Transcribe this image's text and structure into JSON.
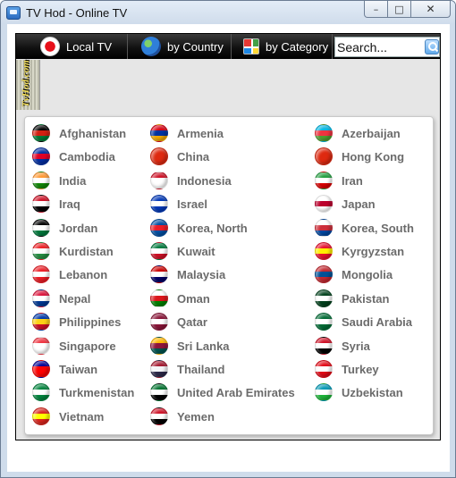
{
  "window": {
    "title": "TV Hod - Online TV",
    "controls": {
      "minimize": "–",
      "maximize": "□",
      "close": "✕"
    }
  },
  "nav": {
    "local": "Local TV",
    "country": "by Country",
    "category": "by Category",
    "search_placeholder": "Search..."
  },
  "logo": "TvHod.com",
  "countries": [
    {
      "name": "Afghanistan",
      "colors": [
        "#000000",
        "#d32011",
        "#007a36"
      ]
    },
    {
      "name": "Armenia",
      "colors": [
        "#d90012",
        "#0033a0",
        "#f2a800"
      ]
    },
    {
      "name": "Azerbaijan",
      "colors": [
        "#00b5e2",
        "#ef3340",
        "#509e2f"
      ]
    },
    {
      "name": "Cambodia",
      "colors": [
        "#032ea1",
        "#e00025",
        "#032ea1"
      ]
    },
    {
      "name": "China",
      "colors": [
        "#de2910",
        "#de2910",
        "#de2910"
      ]
    },
    {
      "name": "Hong Kong",
      "colors": [
        "#de2910",
        "#de2910",
        "#de2910"
      ]
    },
    {
      "name": "India",
      "colors": [
        "#ff9933",
        "#ffffff",
        "#138808"
      ]
    },
    {
      "name": "Indonesia",
      "colors": [
        "#ce1126",
        "#ffffff",
        "#ffffff"
      ]
    },
    {
      "name": "Iran",
      "colors": [
        "#239f40",
        "#ffffff",
        "#da0000"
      ]
    },
    {
      "name": "Iraq",
      "colors": [
        "#ce1126",
        "#ffffff",
        "#000000"
      ]
    },
    {
      "name": "Israel",
      "colors": [
        "#0038b8",
        "#ffffff",
        "#0038b8"
      ]
    },
    {
      "name": "Japan",
      "colors": [
        "#ffffff",
        "#bc002d",
        "#ffffff"
      ]
    },
    {
      "name": "Jordan",
      "colors": [
        "#000000",
        "#ffffff",
        "#007a3d"
      ]
    },
    {
      "name": "Korea, North",
      "colors": [
        "#024fa2",
        "#ed1c27",
        "#024fa2"
      ]
    },
    {
      "name": "Korea, South",
      "colors": [
        "#ffffff",
        "#cd2e3a",
        "#0047a0"
      ]
    },
    {
      "name": "Kurdistan",
      "colors": [
        "#ed2024",
        "#ffffff",
        "#278e43"
      ]
    },
    {
      "name": "Kuwait",
      "colors": [
        "#007a3d",
        "#ffffff",
        "#ce1126"
      ]
    },
    {
      "name": "Kyrgyzstan",
      "colors": [
        "#e8112d",
        "#ffef00",
        "#e8112d"
      ]
    },
    {
      "name": "Lebanon",
      "colors": [
        "#ed1c24",
        "#ffffff",
        "#ed1c24"
      ]
    },
    {
      "name": "Malaysia",
      "colors": [
        "#cc0001",
        "#ffffff",
        "#010066"
      ]
    },
    {
      "name": "Mongolia",
      "colors": [
        "#c4272f",
        "#015197",
        "#c4272f"
      ]
    },
    {
      "name": "Nepal",
      "colors": [
        "#dc143c",
        "#ffffff",
        "#003893"
      ]
    },
    {
      "name": "Oman",
      "colors": [
        "#ffffff",
        "#db161b",
        "#008000"
      ]
    },
    {
      "name": "Pakistan",
      "colors": [
        "#01411c",
        "#ffffff",
        "#01411c"
      ]
    },
    {
      "name": "Philippines",
      "colors": [
        "#0038a8",
        "#fcd116",
        "#ce1126"
      ]
    },
    {
      "name": "Qatar",
      "colors": [
        "#8a1538",
        "#ffffff",
        "#8a1538"
      ]
    },
    {
      "name": "Saudi Arabia",
      "colors": [
        "#006c35",
        "#ffffff",
        "#006c35"
      ]
    },
    {
      "name": "Singapore",
      "colors": [
        "#ef3340",
        "#ffffff",
        "#ffffff"
      ]
    },
    {
      "name": "Sri Lanka",
      "colors": [
        "#ffb700",
        "#8d153a",
        "#00534e"
      ]
    },
    {
      "name": "Syria",
      "colors": [
        "#ce1126",
        "#ffffff",
        "#000000"
      ]
    },
    {
      "name": "Taiwan",
      "colors": [
        "#000095",
        "#fe0000",
        "#fe0000"
      ]
    },
    {
      "name": "Thailand",
      "colors": [
        "#a51931",
        "#f4f5f8",
        "#2d2a4a"
      ]
    },
    {
      "name": "Turkey",
      "colors": [
        "#e30a17",
        "#ffffff",
        "#e30a17"
      ]
    },
    {
      "name": "Turkmenistan",
      "colors": [
        "#00843d",
        "#ffffff",
        "#00843d"
      ]
    },
    {
      "name": "United Arab Emirates",
      "colors": [
        "#00732f",
        "#ffffff",
        "#000000"
      ]
    },
    {
      "name": "Uzbekistan",
      "colors": [
        "#0099b5",
        "#ffffff",
        "#1eb53a"
      ]
    },
    {
      "name": "Vietnam",
      "colors": [
        "#da251d",
        "#ffff00",
        "#da251d"
      ]
    },
    {
      "name": "Yemen",
      "colors": [
        "#ce1126",
        "#ffffff",
        "#000000"
      ]
    }
  ]
}
